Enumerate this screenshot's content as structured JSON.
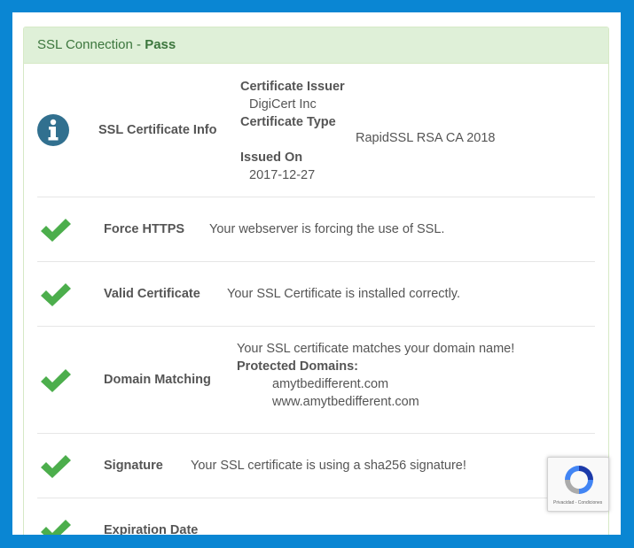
{
  "panel": {
    "title_prefix": "SSL Connection",
    "title_sep": " - ",
    "title_status": "Pass"
  },
  "rows": {
    "info": {
      "label": "SSL Certificate Info",
      "issuer_key": "Certificate Issuer",
      "issuer_value": "DigiCert Inc",
      "type_key": "Certificate Type",
      "type_value": "RapidSSL RSA CA 2018",
      "issued_key": "Issued On",
      "issued_value": "2017-12-27"
    },
    "force_https": {
      "label": "Force HTTPS",
      "desc": "Your webserver is forcing the use of SSL."
    },
    "valid_cert": {
      "label": "Valid Certificate",
      "desc": "Your SSL Certificate is installed correctly."
    },
    "domain_matching": {
      "label": "Domain Matching",
      "desc": "Your SSL certificate matches your domain name!",
      "domains_key": "Protected Domains:",
      "domains": [
        "amytbedifferent.com",
        "www.amytbedifferent.com"
      ]
    },
    "signature": {
      "label": "Signature",
      "desc": "Your SSL certificate is using a sha256 signature!"
    },
    "expiration": {
      "label": "Expiration Date"
    }
  },
  "recaptcha": {
    "text": "Privacidad - Condiciones"
  },
  "colors": {
    "check": "#4cae4c",
    "info": "#31708f",
    "heading_bg": "#dff0d8",
    "heading_text": "#3c763d",
    "outer_bg": "#0a86d3"
  },
  "icons": {
    "info": "info-circle-icon",
    "check": "check-icon",
    "recaptcha": "recaptcha-logo-icon"
  }
}
